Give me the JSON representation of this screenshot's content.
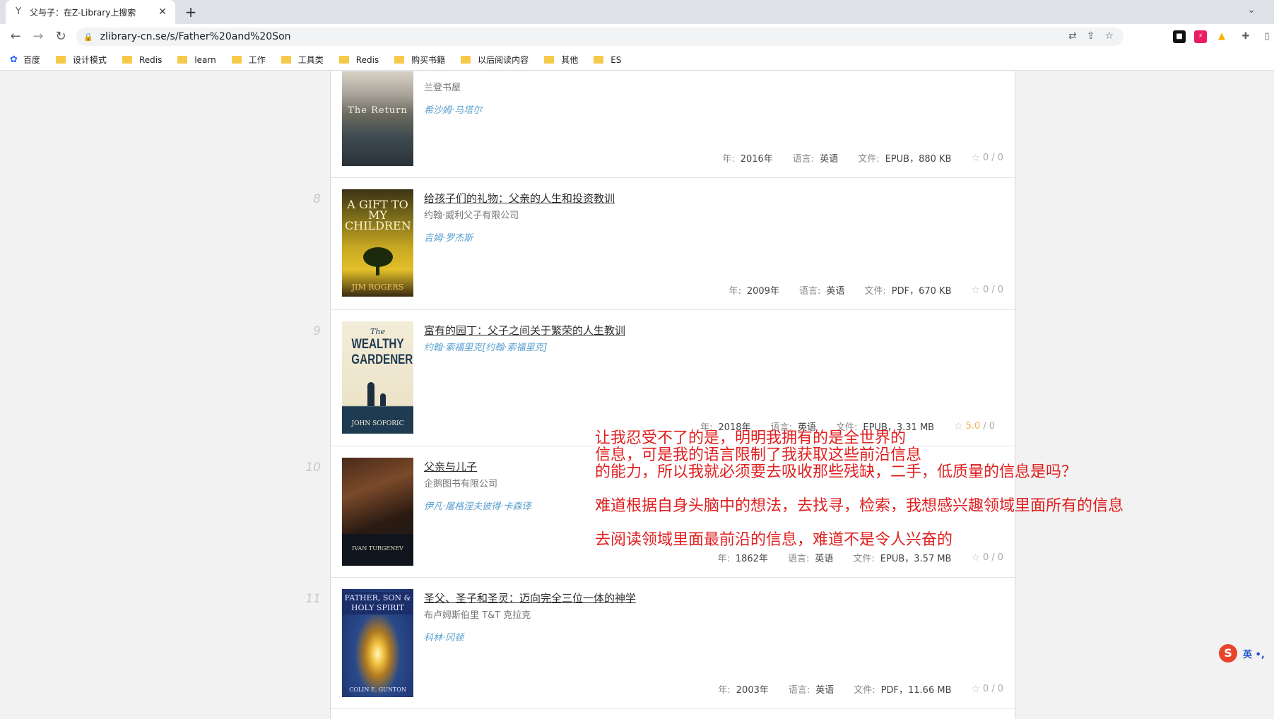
{
  "browser": {
    "tab_title": "父与子：在Z-Library上搜索",
    "tab_favicon": "Y",
    "url": "zlibrary-cn.se/s/Father%20and%20Son",
    "bookmarks": [
      "百度",
      "设计模式",
      "Redis",
      "learn",
      "工作",
      "工具类",
      "Redis",
      "购买书籍",
      "以后阅读内容",
      "其他",
      "ES"
    ]
  },
  "labels": {
    "year": "年:",
    "language": "语言:",
    "file": "文件:",
    "slash": "/"
  },
  "books": [
    {
      "title": "",
      "publisher": "兰登书屋",
      "author": "希沙姆·马塔尔",
      "year": "2016年",
      "language": "英语",
      "file": "EPUB，880 KB",
      "rating": "0",
      "count": "0",
      "cover_text": "The Return"
    },
    {
      "number": "8",
      "title": "给孩子们的礼物：父亲的人生和投资教训",
      "publisher": "约翰·威利父子有限公司",
      "author": "吉姆·罗杰斯",
      "year": "2009年",
      "language": "英语",
      "file": "PDF，670 KB",
      "rating": "0",
      "count": "0",
      "cover_text": "A GIFT TO MY CHILDREN",
      "cover_author": "JIM ROGERS"
    },
    {
      "number": "9",
      "title": "富有的园丁：父子之间关于繁荣的人生教训",
      "author": "约翰·索福里克[约翰·索福里克]",
      "year": "2018年",
      "language": "英语",
      "file": "EPUB，3.31 MB",
      "rating": "5.0",
      "count": "0",
      "cover_text": "WEALTHY GARDENER",
      "cover_pre": "The",
      "cover_author": "JOHN SOFORIC"
    },
    {
      "number": "10",
      "title": "父亲与儿子",
      "publisher": "企鹅图书有限公司",
      "author": "伊凡·屠格涅夫彼得·卡森译",
      "year": "1862年",
      "language": "英语",
      "file": "EPUB，3.57 MB",
      "rating": "0",
      "count": "0",
      "cover_text": "IVAN TURGENEV"
    },
    {
      "number": "11",
      "title": "圣父、圣子和圣灵：迈向完全三位一体的神学",
      "publisher": "布卢姆斯伯里 T&T 克拉克",
      "author": "科林·冈顿",
      "year": "2003年",
      "language": "英语",
      "file": "PDF，11.66 MB",
      "rating": "0",
      "count": "0",
      "cover_text": "FATHER, SON & HOLY SPIRIT",
      "cover_author": "COLIN E. GUNTON"
    }
  ],
  "annotation": {
    "line1": "让我忍受不了的是，明明我拥有的是全世界的",
    "line2": "信息，可是我的语言限制了我获取这些前沿信息",
    "line3": "的能力，所以我就必须要去吸收那些残缺，二手，低质量的信息是吗？",
    "line4": "难道根据自身头脑中的想法，去找寻，检索，我想感兴趣领域里面所有的信息",
    "line5": "去阅读领域里面最前沿的信息，难道不是令人兴奋的"
  },
  "ime": {
    "logo": "S",
    "label": "英 •,"
  },
  "colors": {
    "annotation": "#e02020",
    "author_link": "#5aa0d0",
    "rating_star": "#f0ad4e"
  }
}
